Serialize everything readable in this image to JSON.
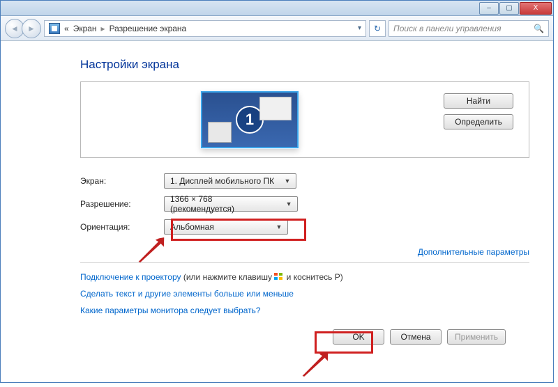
{
  "titlebar": {
    "minimize": "–",
    "maximize": "▢",
    "close": "X"
  },
  "breadcrumb": {
    "prefix": "«",
    "item1": "Экран",
    "item2": "Разрешение экрана"
  },
  "search": {
    "placeholder": "Поиск в панели управления"
  },
  "heading": "Настройки экрана",
  "side": {
    "find": "Найти",
    "identify": "Определить"
  },
  "monitor": {
    "number": "1"
  },
  "form": {
    "screen_label": "Экран:",
    "screen_value": "1. Дисплей мобильного ПК",
    "resolution_label": "Разрешение:",
    "resolution_value": "1366 × 768 (рекомендуется)",
    "orientation_label": "Ориентация:",
    "orientation_value": "Альбомная"
  },
  "extras": {
    "additional": "Дополнительные параметры"
  },
  "links": {
    "projector_pre": "Подключение к проектору",
    "projector_post_a": " (или нажмите клавишу ",
    "projector_post_b": " и коснитесь P)",
    "textsize": "Сделать текст и другие элементы больше или меньше",
    "which": "Какие параметры монитора следует выбрать?"
  },
  "footer": {
    "ok": "OK",
    "cancel": "Отмена",
    "apply": "Применить"
  }
}
